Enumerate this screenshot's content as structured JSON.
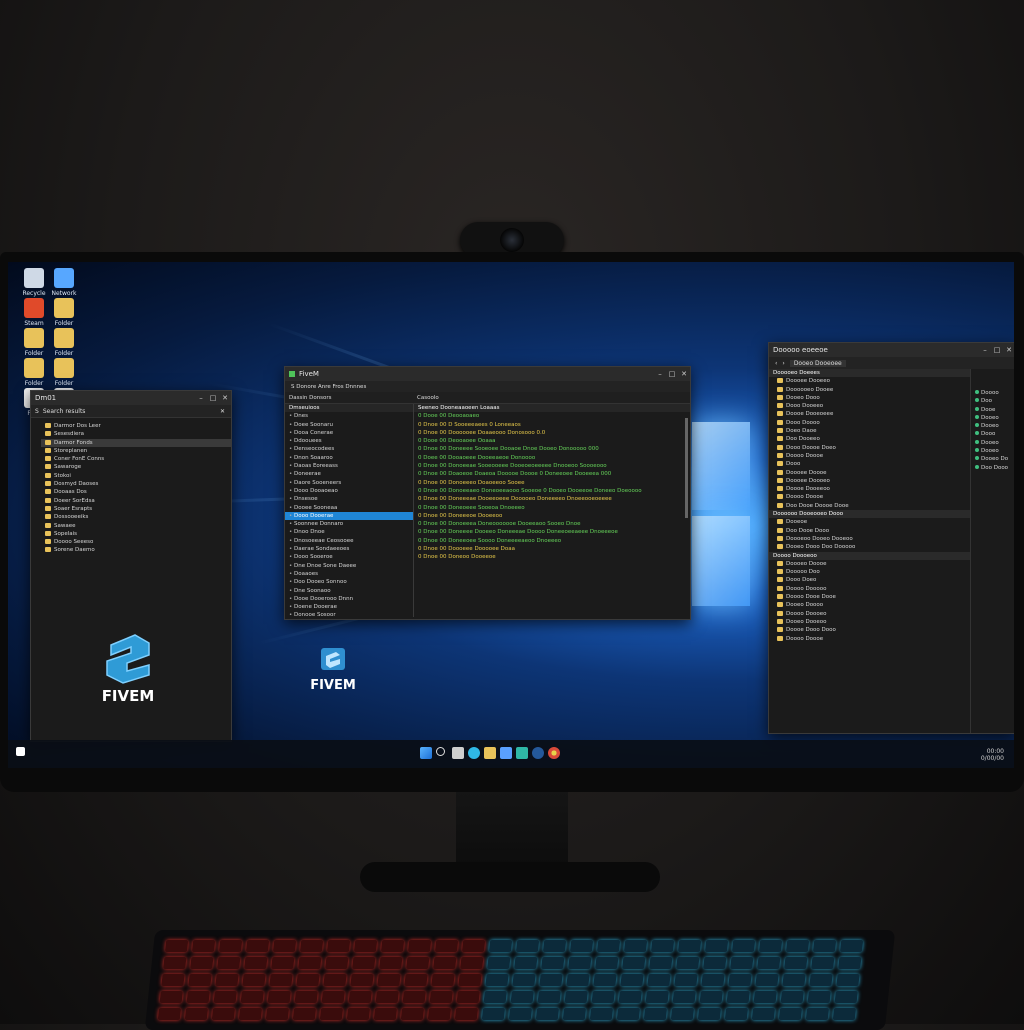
{
  "desktop": {
    "icons": [
      {
        "label": "Recycle",
        "icon": "recycle-bin-icon",
        "color": "#cfd9e6"
      },
      {
        "label": "Network",
        "icon": "network-icon",
        "color": "#57a7ff"
      },
      {
        "label": "Steam",
        "icon": "app-icon",
        "color": "#e04a2a"
      },
      {
        "label": "Folder",
        "icon": "folder-icon",
        "color": "#e8c25a"
      },
      {
        "label": "Folder",
        "icon": "folder-icon",
        "color": "#e8c25a"
      },
      {
        "label": "Folder",
        "icon": "folder-icon",
        "color": "#e8c25a"
      },
      {
        "label": "Folder",
        "icon": "folder-icon",
        "color": "#e8c25a"
      },
      {
        "label": "Folder",
        "icon": "folder-icon",
        "color": "#e8c25a"
      },
      {
        "label": "Files",
        "icon": "document-icon",
        "color": "#f1f1f1"
      },
      {
        "label": "Files",
        "icon": "document-icon",
        "color": "#f1f1f1"
      }
    ]
  },
  "left_window": {
    "title": "Dm01",
    "tab": "S",
    "header": "Search results",
    "items": [
      "Darmor Dos Leer",
      "Sesesdiera",
      "Darmor Fonds",
      "Storeplanen",
      "Coner FonE Conns",
      "Sawaroge",
      "Stokoi",
      "Dosmyd Daoses",
      "Dooaas Dos",
      "Doeer SorEdsa",
      "Soaer Esrapts",
      "Dossooeeiks",
      "Sawaee",
      "Sopelais",
      "Doooo Seeeso",
      "Sorene Daemo"
    ],
    "selected_index": 2,
    "brand": "FIVEM"
  },
  "center_window": {
    "title": "FiveM",
    "toolbar_label": "S Donore Anre Fros Dnnnes",
    "tab_left": "Dassin Donsors",
    "tab_right": "Casoolo",
    "tree_header": "Dmseuioos",
    "tree_items": [
      "Dnes",
      "Doee Soonaru",
      "Dooa Conerae",
      "Ddoouees",
      "Denseocodees",
      "Dnon Soaaroo",
      "Daoas Eoreeass",
      "Doneerae",
      "Daore Sooeneers",
      "Dooo Dooaoeao",
      "Dnsesoe",
      "Dooee Sooneaa",
      "Dooo Dooerae",
      "Soonnee Donnaro",
      "Dnoo Dnoe",
      "Dnosoeeae Ceosooee",
      "Daerae Sondaeeoes",
      "Dooo Sooeroe",
      "Dne Dnoe Sone Daeee",
      "Doaaoes",
      "Doo Dooeo Sonnoo",
      "Dne Soonaoo",
      "Dooe Dooerooo Dnnn",
      "Doene Dooerae",
      "Donooe Sosoor"
    ],
    "tree_selected_index": 12,
    "console_header": "Seeneo Dooneaaoeen Loaaas",
    "console_lines": [
      {
        "text": "0 Dooe 00 Deooaoaeo",
        "level": "ok"
      },
      {
        "text": "0 Dnoe 00 D Sooeeeaees 0 Loneeaos",
        "level": "warn"
      },
      {
        "text": "0 Dnoe 00 Doooooee Doaaeooo Donosooo 0.0",
        "level": "warn"
      },
      {
        "text": "0 Dooe 00 Deooaoee Ooaaa",
        "level": "ok"
      },
      {
        "text": "0 Dnoe 00 Doneeee Sooeoee Dooaoe Dnoe Dooeo Donooooo 000",
        "level": "ok"
      },
      {
        "text": "0 Doee 00 Dooaoeee Dooeeaeoe Donoooo",
        "level": "ok"
      },
      {
        "text": "0 Dnoe 00 Donoeeae Sooeooeee Dooeoeoeeeee Dnooeoo Soooeooo",
        "level": "ok"
      },
      {
        "text": "0 Dnoe 00 Doaoeoe Doaeoa Dooooe Doooe 0 Doneeoee Dooeeea 000",
        "level": "ok"
      },
      {
        "text": "0 Dnoe 00 Donoeeeo Doaoeeoo Sooee",
        "level": "warn"
      },
      {
        "text": "0 Dnoe 00 Donoeeaeo Doneoeeaooo Sooeoe 0 Dooeo Dooeeoe Doneeo Doeoooo",
        "level": "ok"
      },
      {
        "text": "0 Dnoe 00 Doneeeae Dooeeoeee Dooooeo Doneeeeo Dnoeeooeoeeee",
        "level": "warn"
      },
      {
        "text": "0 Dnoe 00 Doneoeee Sooeoa Dnoeeeo",
        "level": "ok"
      },
      {
        "text": "0 Dnoe 00 Doneeeoe Dooeeoo",
        "level": "warn"
      },
      {
        "text": "0 Dnoe 00 Donoeeea Doneooooooe Dooeeaoo Sooeo Dnoe",
        "level": "ok"
      },
      {
        "text": "0 Dnoe 00 Doneeee Dooeeo Doneeeae Doooo Doneeoeeaeee Dnoeeeoe",
        "level": "ok"
      },
      {
        "text": "0 Dnoe 00 Doneeoee Soooo Doneeeeaeoo Dnoeeeo",
        "level": "ok"
      },
      {
        "text": "0 Dnoe 00 Doooeee Dooooee Doaa",
        "level": "warn"
      },
      {
        "text": "0 Dnoe 00 Doneoo Dooeeoe",
        "level": "warn"
      }
    ]
  },
  "desktop_brand": "FIVEM",
  "right_window": {
    "title": "Dooooo eoeeoe",
    "address": "Dooeo Dooeoee",
    "section_a": "Dooooeo Doeees",
    "folders_a": [
      "Doooee Dooeeo",
      "Doooooeo Dooee",
      "Dooeo Dooo",
      "Dooo Dooeeo",
      "Doooe Dooeoeee",
      "Dooo Doooo",
      "Doeo Daoe",
      "Doo Dooeeo",
      "Dooo Doooe Doeo",
      "Doooo Doooe",
      "Dooo",
      "Doooee Doooe",
      "Doooee Doooeo",
      "Doooe Dooeeoo",
      "Doooo Doooe",
      "Doo Dooe Doooe Dooe"
    ],
    "section_b": "Doooooo Dooeooeo Dooo",
    "folders_b": [
      "Dooeoe",
      "Doo Dooe Dooo",
      "Doooeoo Dooeo Dooeoo",
      "Dooeo Dooo Doo Dooooo"
    ],
    "section_c": "Doooo Doooeoo",
    "folders_c": [
      "Doooeo Doooe",
      "Dooooo Doo",
      "Dooo Doeo",
      "Doooo Dooooo",
      "Doooo Dooe Dooe",
      "Dooeo Doooo",
      "Doooo Doooeo",
      "Dooeo Dooeoo",
      "Doooe Dooo Dooo",
      "Doooo Doooe"
    ],
    "side_items": [
      "Doooo",
      "Doo",
      "Dooe",
      "Dooeo",
      "Dooeo",
      "Dooo",
      "Dooeo",
      "Dooeo",
      "Dooeo Do",
      "Doo Dooo"
    ]
  },
  "taskbar": {
    "time": "00:00",
    "date": "0/00/00"
  }
}
